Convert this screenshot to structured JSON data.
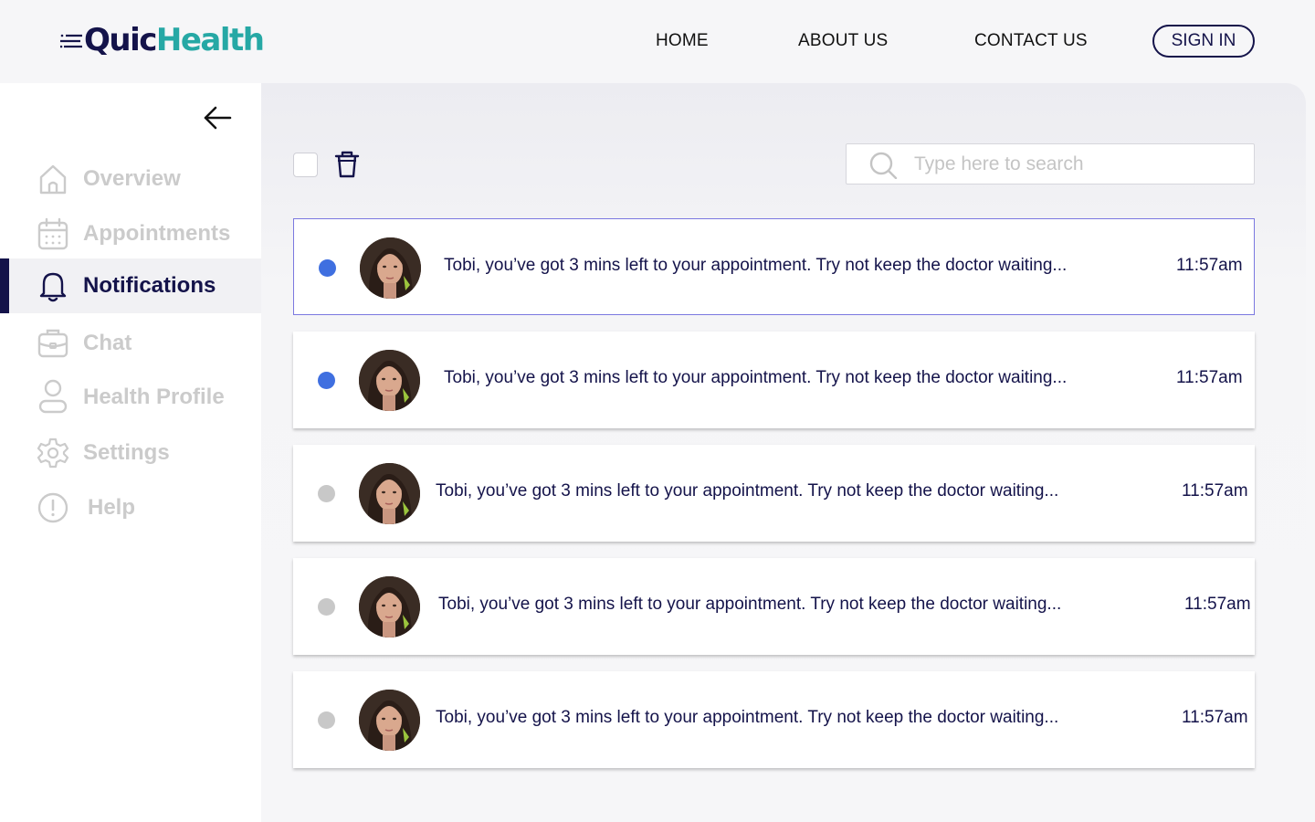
{
  "brand": {
    "logo_q": "Q",
    "logo_uic": "uic",
    "logo_health": "Health",
    "primary": "#14134a",
    "accent": "#26a8a5"
  },
  "nav": {
    "home": "HOME",
    "about": "ABOUT US",
    "contact": "CONTACT US",
    "signin": "SIGN IN"
  },
  "sidebar": {
    "back_icon": "arrow-left-icon",
    "items": [
      {
        "label": "Overview",
        "icon": "home-icon",
        "active": false
      },
      {
        "label": "Appointments",
        "icon": "calendar-icon",
        "active": false
      },
      {
        "label": "Notifications",
        "icon": "bell-icon",
        "active": true
      },
      {
        "label": "Chat",
        "icon": "chat-icon",
        "active": false
      },
      {
        "label": "Health Profile",
        "icon": "user-icon",
        "active": false
      },
      {
        "label": "Settings",
        "icon": "gear-icon",
        "active": false
      },
      {
        "label": "Help",
        "icon": "alert-circle-icon",
        "active": false
      }
    ]
  },
  "toolbar": {
    "search_placeholder": "Type here to search"
  },
  "notifications": [
    {
      "message": "Tobi, you’ve got 3 mins left to your appointment. Try not keep the doctor waiting...",
      "time": "11:57am",
      "unread": true,
      "selected": true
    },
    {
      "message": "Tobi, you’ve got 3 mins left to your appointment. Try not keep the doctor waiting...",
      "time": "11:57am",
      "unread": true,
      "selected": false
    },
    {
      "message": "Tobi, you’ve got 3 mins left to your appointment. Try not keep the doctor waiting...",
      "time": "11:57am",
      "unread": false,
      "selected": false
    },
    {
      "message": "Tobi, you’ve got 3 mins left to your appointment. Try not keep the doctor waiting...",
      "time": "11:57am",
      "unread": false,
      "selected": false
    },
    {
      "message": "Tobi, you’ve got 3 mins left to your appointment. Try not keep the doctor waiting...",
      "time": "11:57am",
      "unread": false,
      "selected": false
    }
  ],
  "colors": {
    "unread_dot": "#3f6fe0",
    "read_dot": "#c8c8c8"
  }
}
